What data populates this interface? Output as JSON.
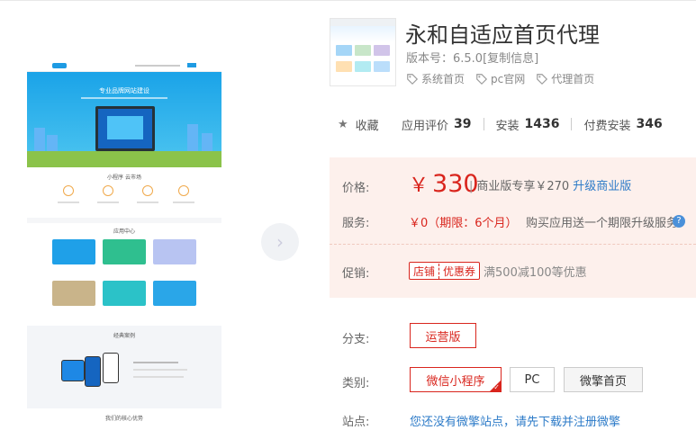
{
  "app": {
    "title": "永和自适应首页代理",
    "version_label": "版本号：6.5.0",
    "copy_info": "[复制信息]",
    "tags": [
      {
        "label": "系统首页",
        "icon": "tag-icon"
      },
      {
        "label": "pc官网",
        "icon": "tag-icon"
      },
      {
        "label": "代理首页",
        "icon": "tag-icon"
      }
    ]
  },
  "preview": {
    "hero_title": "专业品牌网站建设",
    "section1": "小程序 云市场",
    "section2": "应用中心",
    "section3": "经典案例",
    "section4": "我们的核心优势"
  },
  "stats": {
    "favorite_label": "收藏",
    "rating_label": "应用评价",
    "rating_value": "39",
    "install_label": "安装",
    "install_value": "1436",
    "paid_label": "付费安装",
    "paid_value": "346"
  },
  "pricing": {
    "price_label": "价格:",
    "price_symbol": "￥",
    "price_value": "330",
    "biz_sep": "|",
    "biz_text": "商业版专享￥270",
    "upgrade_link": "升级商业版",
    "service_label": "服务:",
    "service_value": "￥0（期限：6个月）",
    "service_desc": "购买应用送一个期限升级服务",
    "help_icon_text": "?",
    "promo_label": "促销:",
    "coupon_part1": "店铺",
    "coupon_part2": "优惠券",
    "promo_text": "满500减100等优惠"
  },
  "options": {
    "branch_label": "分支:",
    "branch_value": "运营版",
    "category_label": "类别:",
    "categories": [
      "微信小程序",
      "PC",
      "微擎首页"
    ],
    "site_label": "站点:",
    "site_link": "您还没有微擎站点，请先下载并注册微擎"
  },
  "colors": {
    "accent_red": "#d9251d",
    "link_blue": "#2d7bc8",
    "price_bg": "#fdf0ec"
  }
}
